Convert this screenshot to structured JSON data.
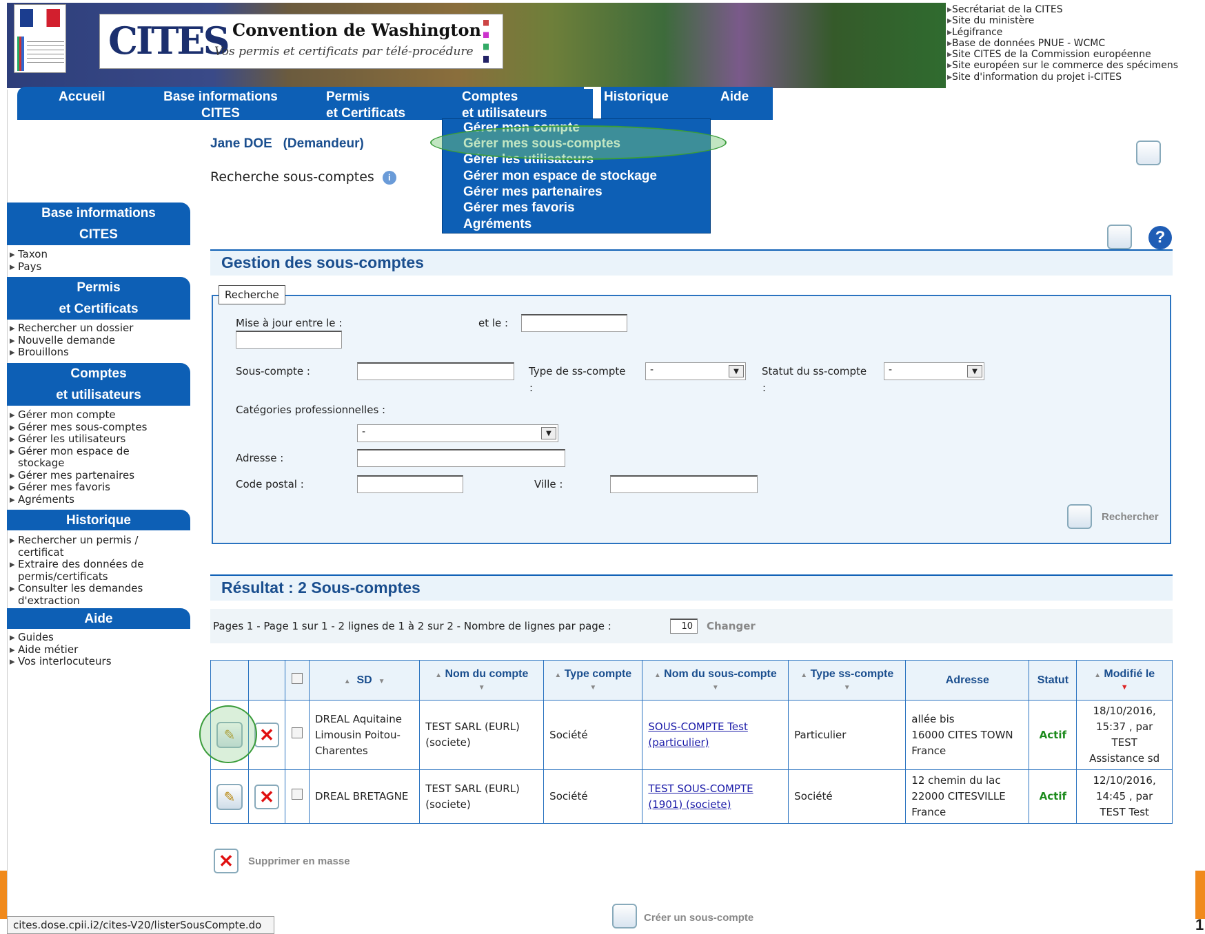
{
  "banner": {
    "title": "Convention de Washington",
    "subtitle": "Vos permis et certificats par télé-procédure",
    "logo_text": "CITES"
  },
  "external_links": [
    "Secrétariat de la CITES",
    "Site du ministère",
    "Légifrance",
    "Base de données PNUE - WCMC",
    "Site CITES de la Commission européenne",
    "Site européen sur le commerce des spécimens",
    "Site d'information du projet i-CITES"
  ],
  "topnav": {
    "accueil": "Accueil",
    "base_info_1": "Base informations",
    "base_info_2": "CITES",
    "permis_1": "Permis",
    "permis_2": "et Certificats",
    "comptes_1": "Comptes",
    "comptes_2": "et utilisateurs",
    "historique": "Historique",
    "aide": "Aide"
  },
  "dropdown": [
    "Gérer mon compte",
    "Gérer mes sous-comptes",
    "Gérer les utilisateurs",
    "Gérer mon espace de stockage",
    "Gérer mes partenaires",
    "Gérer mes favoris",
    "Agréments"
  ],
  "user": {
    "name": "Jane DOE",
    "role": "(Demandeur)"
  },
  "page_heading": "Recherche sous-comptes",
  "sidebar": {
    "base_info": {
      "title1": "Base informations",
      "title2": "CITES",
      "items": [
        "Taxon",
        "Pays"
      ]
    },
    "permis": {
      "title1": "Permis",
      "title2": "et Certificats",
      "items": [
        "Rechercher un dossier",
        "Nouvelle demande",
        "Brouillons"
      ]
    },
    "comptes": {
      "title1": "Comptes",
      "title2": "et utilisateurs",
      "items": [
        "Gérer mon compte",
        "Gérer mes sous-comptes",
        "Gérer les utilisateurs",
        "Gérer mon espace de stockage",
        "Gérer mes partenaires",
        "Gérer mes favoris",
        "Agréments"
      ]
    },
    "historique": {
      "title": "Historique",
      "items": [
        "Rechercher un permis / certificat",
        "Extraire des données de permis/certificats",
        "Consulter les demandes d'extraction"
      ]
    },
    "aide": {
      "title": "Aide",
      "items": [
        "Guides",
        "Aide métier",
        "Vos interlocuteurs"
      ]
    }
  },
  "gestion": {
    "title": "Gestion des sous-comptes"
  },
  "search": {
    "legend": "Recherche",
    "maj_label": "Mise à jour entre le :",
    "et_le_label": "et le :",
    "sous_compte_label": "Sous-compte :",
    "type_label": "Type de ss-compte",
    "type_colon": ":",
    "type_value": "-",
    "statut_label": "Statut du ss-compte",
    "statut_colon": ":",
    "statut_value": "-",
    "categories_label": "Catégories professionnelles :",
    "categories_value": "-",
    "adresse_label": "Adresse :",
    "code_postal_label": "Code postal :",
    "ville_label": "Ville :",
    "search_button": "Rechercher"
  },
  "result": {
    "title": "Résultat : 2 Sous-comptes"
  },
  "pager": {
    "text": "Pages  1 - Page 1 sur 1 - 2 lignes de 1 à 2 sur 2 - Nombre de lignes par page :",
    "per_page": "10",
    "change": "Changer"
  },
  "table": {
    "headers": {
      "sd": "SD",
      "nom_compte": "Nom du compte",
      "type_compte": "Type compte",
      "nom_sous_compte": "Nom du sous-compte",
      "type_ss_compte": "Type ss-compte",
      "adresse": "Adresse",
      "statut": "Statut",
      "modifie_le": "Modifié le"
    },
    "rows": [
      {
        "sd": "DREAL Aquitaine Limousin Poitou-Charentes",
        "nom_compte": "TEST SARL (EURL) (societe)",
        "type_compte": "Société",
        "nom_sous_compte": "SOUS-COMPTE Test (particulier)",
        "type_ss_compte": "Particulier",
        "adresse1": "allée bis",
        "adresse2": "16000 CITES TOWN",
        "adresse3": "France",
        "statut": "Actif",
        "modifie": "18/10/2016, 15:37 , par TEST Assistance sd"
      },
      {
        "sd": "DREAL BRETAGNE",
        "nom_compte": "TEST SARL (EURL) (societe)",
        "type_compte": "Société",
        "nom_sous_compte": "TEST SOUS-COMPTE (1901) (societe)",
        "type_ss_compte": "Société",
        "adresse1": "12 chemin du lac",
        "adresse2": "22000 CITESVILLE",
        "adresse3": "France",
        "statut": "Actif",
        "modifie": "12/10/2016, 14:45 , par TEST Test"
      }
    ]
  },
  "actions": {
    "mass_delete": "Supprimer en masse",
    "create": "Créer un sous-compte"
  },
  "statusbar": "cites.dose.cpii.i2/cites-V20/listerSousCompte.do",
  "corner_digit": "1",
  "colors": {
    "nav_blue": "#0d5fb5",
    "title_blue": "#1a4e8e",
    "actif_green": "#1c8b1c",
    "highlight_green": "#3a9c3a"
  }
}
